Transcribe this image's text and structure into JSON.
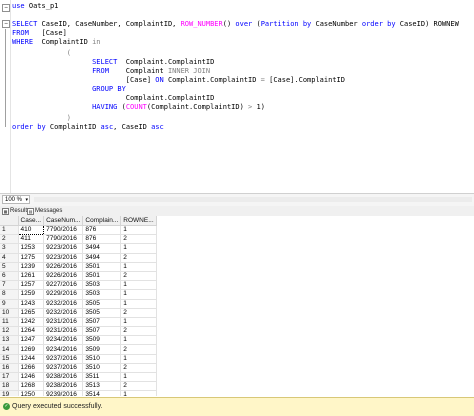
{
  "editor": {
    "lines": [
      "use Oats_p1",
      "",
      "SELECT CaseID, CaseNumber, ComplaintID, ROW_NUMBER() over (Partition by CaseNumber order by CaseID) ROWNEW",
      "FROM   [Case]",
      "WHERE  ComplaintID in",
      "         (",
      "              SELECT  Complaint.ComplaintID",
      "              FROM    Complaint INNER JOIN",
      "                      [Case] ON Complaint.ComplaintID = [Case].ComplaintID",
      "              GROUP BY",
      "                      Complaint.ComplaintID",
      "              HAVING (COUNT(Complaint.ComplaintID) > 1)",
      "         )",
      "order by ComplaintID asc, CaseID asc"
    ]
  },
  "zoom": {
    "value": "100 %"
  },
  "tabs": {
    "results": "Results",
    "messages": "Messages"
  },
  "grid": {
    "columns": [
      "",
      "Case...",
      "CaseNum...",
      "Complain...",
      "ROWNE..."
    ],
    "rows": [
      [
        "1",
        "410",
        "7790/2016",
        "876",
        "1"
      ],
      [
        "2",
        "411",
        "7790/2016",
        "876",
        "2"
      ],
      [
        "3",
        "1253",
        "9223/2016",
        "3494",
        "1"
      ],
      [
        "4",
        "1275",
        "9223/2016",
        "3494",
        "2"
      ],
      [
        "5",
        "1239",
        "9226/2016",
        "3501",
        "1"
      ],
      [
        "6",
        "1261",
        "9226/2016",
        "3501",
        "2"
      ],
      [
        "7",
        "1257",
        "9227/2016",
        "3503",
        "1"
      ],
      [
        "8",
        "1259",
        "9229/2016",
        "3503",
        "1"
      ],
      [
        "9",
        "1243",
        "9232/2016",
        "3505",
        "1"
      ],
      [
        "10",
        "1265",
        "9232/2016",
        "3505",
        "2"
      ],
      [
        "11",
        "1242",
        "9231/2016",
        "3507",
        "1"
      ],
      [
        "12",
        "1264",
        "9231/2016",
        "3507",
        "2"
      ],
      [
        "13",
        "1247",
        "9234/2016",
        "3509",
        "1"
      ],
      [
        "14",
        "1269",
        "9234/2016",
        "3509",
        "2"
      ],
      [
        "15",
        "1244",
        "9237/2016",
        "3510",
        "1"
      ],
      [
        "16",
        "1266",
        "9237/2016",
        "3510",
        "2"
      ],
      [
        "17",
        "1246",
        "9238/2016",
        "3511",
        "1"
      ],
      [
        "18",
        "1268",
        "9238/2016",
        "3513",
        "2"
      ],
      [
        "19",
        "1250",
        "9239/2016",
        "3514",
        "1"
      ],
      [
        "20",
        "1272",
        "9239/2016",
        "3514",
        "2"
      ],
      [
        "21",
        "1238",
        "9240/2016",
        "3516",
        "1"
      ]
    ]
  },
  "status": {
    "text": "Query executed successfully."
  }
}
